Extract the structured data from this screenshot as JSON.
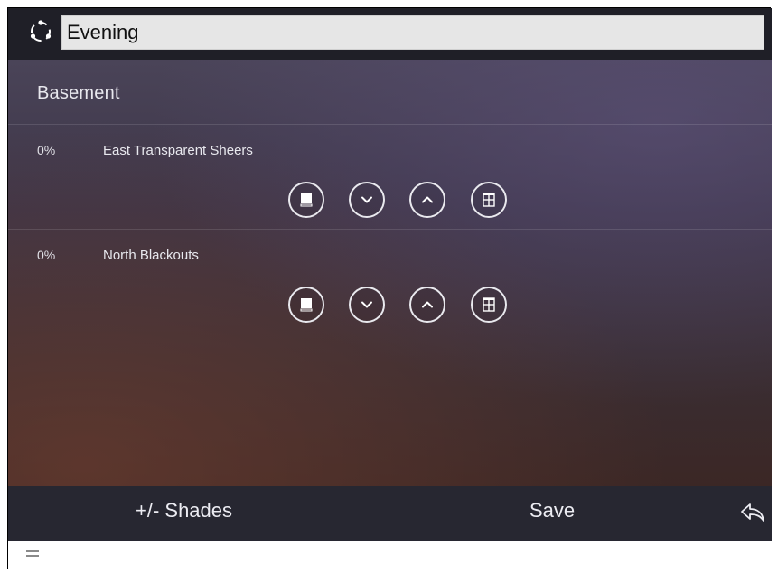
{
  "scene": {
    "icon": "scene-circle-icon",
    "name_value": "Evening"
  },
  "room": {
    "title": "Basement"
  },
  "shades": [
    {
      "percent": "0%",
      "name": "East Transparent Sheers",
      "controls": [
        "shade-closed-icon",
        "chevron-down-icon",
        "chevron-up-icon",
        "shade-open-icon"
      ]
    },
    {
      "percent": "0%",
      "name": "North Blackouts",
      "controls": [
        "shade-closed-icon",
        "chevron-down-icon",
        "chevron-up-icon",
        "shade-open-icon"
      ]
    }
  ],
  "bottom_bar": {
    "shades_label": "+/- Shades",
    "save_label": "Save",
    "back_icon": "reply-back-icon"
  },
  "status_bar": {
    "menu_icon": "hamburger-icon"
  },
  "colors": {
    "title_bar": "#1f1f27",
    "bottom_bar": "#272731",
    "text": "#e8e8ee",
    "input_bg": "#e6e6e6"
  }
}
